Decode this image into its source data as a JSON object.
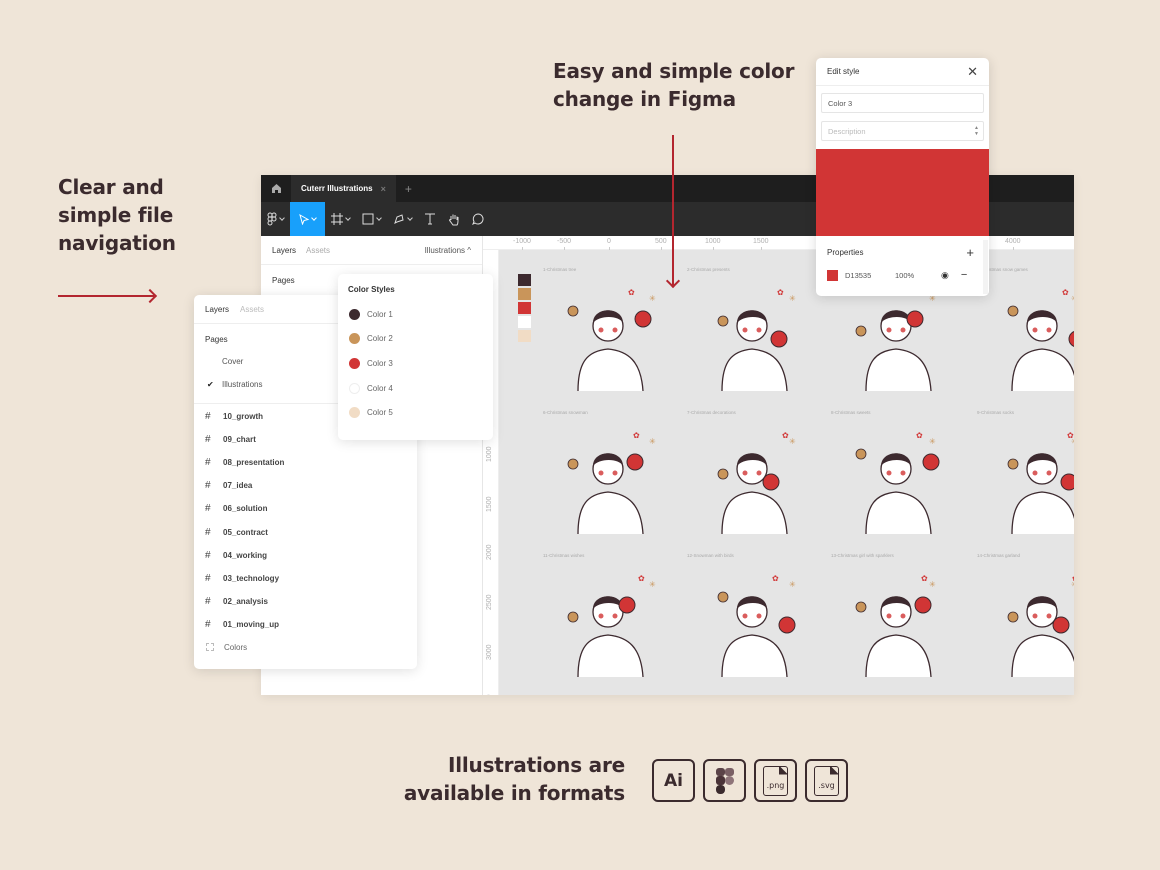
{
  "headlines": {
    "left": "Clear and simple file navigation",
    "top": "Easy and simple color change in Figma",
    "bottom": "Illustrations are available in formats"
  },
  "figma": {
    "tab_title": "Cuterr Illustrations",
    "tab_close": "×",
    "tab_add": "+",
    "tools": [
      "figma-menu",
      "move",
      "frame",
      "rectangle",
      "pen",
      "text",
      "hand",
      "comment"
    ],
    "active_tool": "move",
    "left_panel": {
      "tab_layers": "Layers",
      "tab_assets": "Assets",
      "current_page": "Illustrations ^",
      "pages_label": "Pages"
    },
    "ruler_top": [
      "-1000",
      "-500",
      "0",
      "500",
      "1000",
      "1500",
      "4000"
    ],
    "ruler_left": [
      "1000",
      "1500",
      "2000",
      "2500",
      "3000",
      "3500"
    ],
    "canvas_swatches": [
      "#3d2a2f",
      "#c9955a",
      "#d13535",
      "#ffffff",
      "#f1dcc5"
    ],
    "frames": [
      "1-Christmas tree",
      "2-Christmas presents",
      "",
      "4-Christmas snow games",
      "6-Christmas snowman",
      "7-Christmas decorations",
      "8-Christmas sweets",
      "9-Christmas socks",
      "11-Christmas wishes",
      "12-Snowman with birds",
      "13-Christmas girl with sparklers",
      "14-Christmas garland"
    ]
  },
  "layers_popup": {
    "tab_layers": "Layers",
    "tab_assets": "Assets",
    "pages_label": "Pages",
    "pages": [
      {
        "name": "Cover",
        "checked": false
      },
      {
        "name": "Illustrations",
        "checked": true
      }
    ],
    "check_glyph": "✔",
    "frames": [
      "10_growth",
      "09_chart",
      "08_presentation",
      "07_idea",
      "06_solution",
      "05_contract",
      "04_working",
      "03_technology",
      "02_analysis",
      "01_moving_up"
    ],
    "extra_item": "Colors",
    "hash_glyph": "#"
  },
  "color_styles": {
    "title": "Color Styles",
    "items": [
      {
        "name": "Color 1",
        "color": "#3d2a2f"
      },
      {
        "name": "Color 2",
        "color": "#c9955a"
      },
      {
        "name": "Color 3",
        "color": "#d13535"
      },
      {
        "name": "Color 4",
        "color": "#ffffff"
      },
      {
        "name": "Color 5",
        "color": "#f1dcc5"
      }
    ]
  },
  "edit_style": {
    "title": "Edit style",
    "close": "✕",
    "name_value": "Color 3",
    "description_placeholder": "Description",
    "preview_color": "#d13535",
    "properties_label": "Properties",
    "add": "+",
    "fill_hex": "D13535",
    "fill_opacity": "100%",
    "eye": "◉",
    "remove": "−"
  },
  "formats": [
    {
      "type": "ai",
      "label": "Ai"
    },
    {
      "type": "figma",
      "label": ""
    },
    {
      "type": "png",
      "label": ".png"
    },
    {
      "type": "svg",
      "label": ".svg"
    }
  ],
  "colors": {
    "accent_arrow": "#b3262f",
    "figma_blue": "#18a0fb",
    "background": "#efe5d8"
  }
}
